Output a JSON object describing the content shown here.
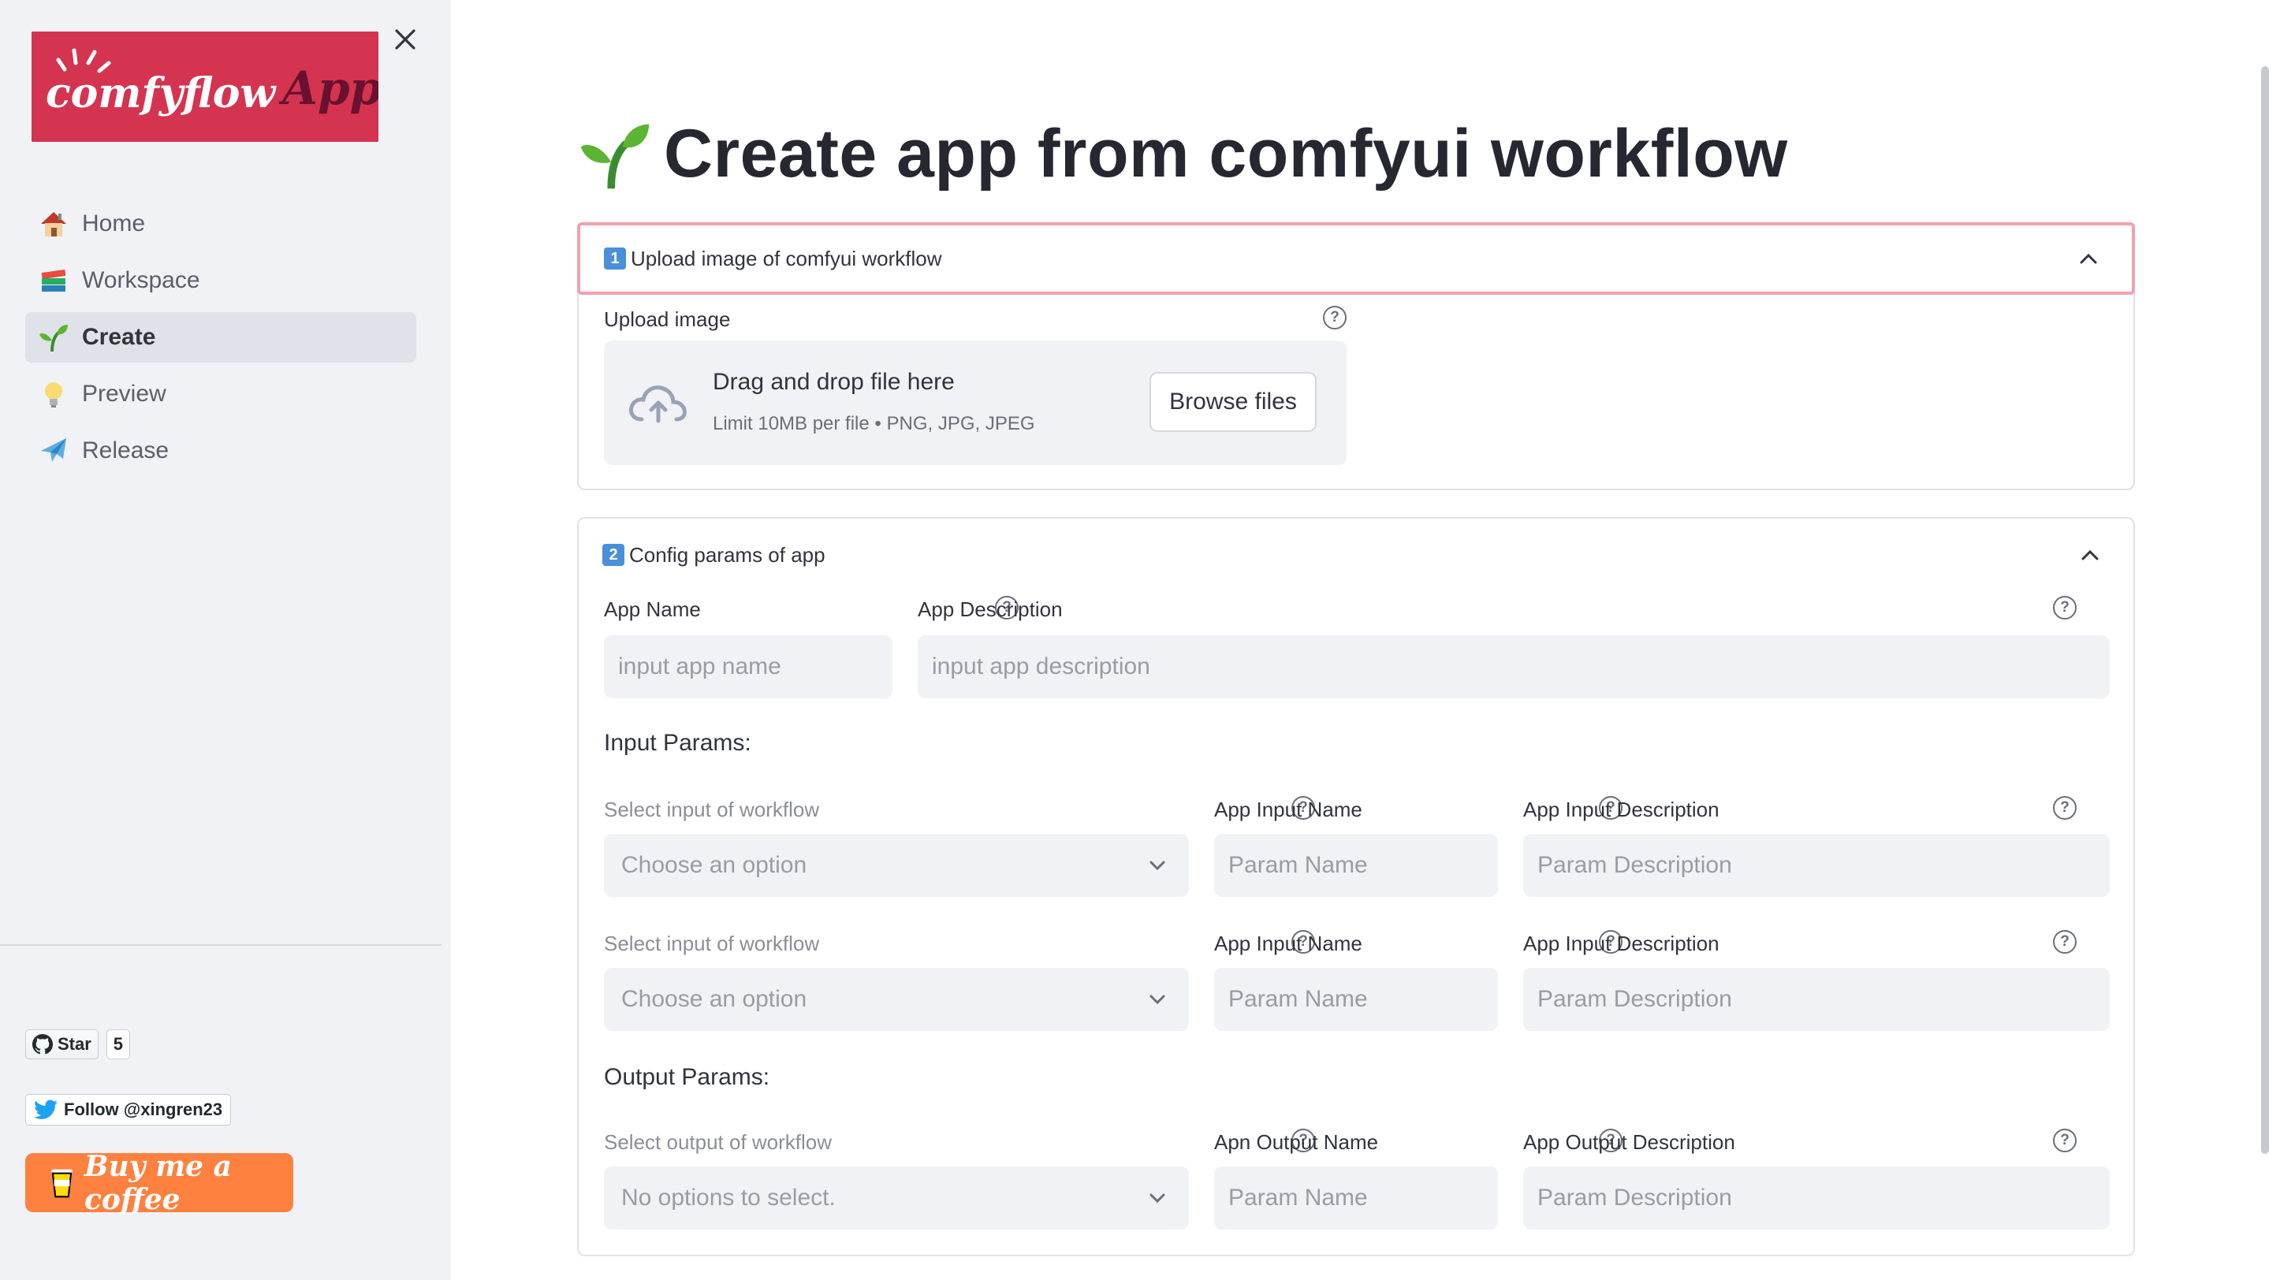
{
  "sidebar": {
    "logo_text": "comfyflowApp",
    "nav": [
      {
        "label": "Home",
        "icon": "house-icon"
      },
      {
        "label": "Workspace",
        "icon": "books-icon"
      },
      {
        "label": "Create",
        "icon": "seedling-icon",
        "active": true
      },
      {
        "label": "Preview",
        "icon": "lightbulb-icon"
      },
      {
        "label": "Release",
        "icon": "airplane-icon"
      }
    ],
    "github": {
      "label": "Star",
      "count": "5"
    },
    "twitter": {
      "label": "Follow @xingren23"
    },
    "coffee": {
      "label": "Buy me a coffee"
    }
  },
  "page": {
    "title": "Create app from comfyui workflow"
  },
  "upload_section": {
    "number": "1",
    "title": "Upload image of comfyui workflow",
    "field_label": "Upload image",
    "dropzone_main": "Drag and drop file here",
    "dropzone_sub": "Limit 10MB per file • PNG, JPG, JPEG",
    "browse_label": "Browse files"
  },
  "config_section": {
    "number": "2",
    "title": "Config params of app",
    "app_name_label": "App Name",
    "app_name_placeholder": "input app name",
    "app_desc_label": "App Description",
    "app_desc_placeholder": "input app description",
    "input_params_heading": "Input Params:",
    "output_params_heading": "Output Params:",
    "input_rows": [
      {
        "select_label": "Select input of workflow",
        "select_value": "Choose an option",
        "name_label": "App Input Name",
        "name_placeholder": "Param Name",
        "desc_label": "App Input Description",
        "desc_placeholder": "Param Description"
      },
      {
        "select_label": "Select input of workflow",
        "select_value": "Choose an option",
        "name_label": "App Input Name",
        "name_placeholder": "Param Name",
        "desc_label": "App Input Description",
        "desc_placeholder": "Param Description"
      }
    ],
    "output_rows": [
      {
        "select_label": "Select output of workflow",
        "select_value": "No options to select.",
        "name_label": "Apn Output Name",
        "name_placeholder": "Param Name",
        "desc_label": "App Output Description",
        "desc_placeholder": "Param Description"
      }
    ]
  },
  "colors": {
    "sidebar_bg": "#f0f2f6",
    "logo_bg": "#d4344f",
    "highlight_border": "#f2a1ad",
    "coffee_bg": "#ff813f",
    "number_badge": "#4a8fd9"
  }
}
